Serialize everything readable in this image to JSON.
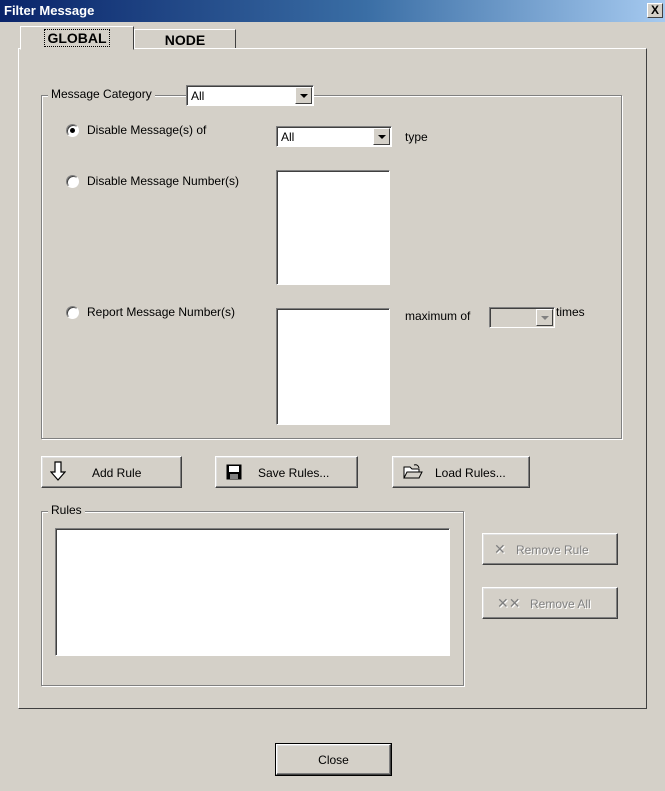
{
  "window": {
    "title": "Filter Message",
    "close_label": "X"
  },
  "tabs": [
    {
      "label": "GLOBAL",
      "active": true
    },
    {
      "label": "NODE",
      "active": false
    }
  ],
  "message_category": {
    "label": "Message Category",
    "value": "All"
  },
  "options": {
    "disable_type": {
      "label": "Disable Message(s) of",
      "value": "All",
      "suffix": "type",
      "checked": true
    },
    "disable_numbers": {
      "label": "Disable Message Number(s)",
      "checked": false
    },
    "report_numbers": {
      "label": "Report Message Number(s)",
      "checked": false,
      "max_label": "maximum of",
      "max_value": "",
      "times_label": "times"
    }
  },
  "actions": {
    "add_rule": {
      "label": "Add Rule",
      "icon": "down-arrow-icon"
    },
    "save_rules": {
      "label": "Save Rules...",
      "icon": "floppy-disk-icon"
    },
    "load_rules": {
      "label": "Load Rules...",
      "icon": "open-folder-icon"
    }
  },
  "rules": {
    "label": "Rules",
    "items": [],
    "remove_rule": {
      "label": "Remove Rule",
      "icon": "x-icon",
      "enabled": false
    },
    "remove_all": {
      "label": "Remove All",
      "icon": "double-x-icon",
      "enabled": false
    }
  },
  "footer": {
    "close_label": "Close"
  }
}
